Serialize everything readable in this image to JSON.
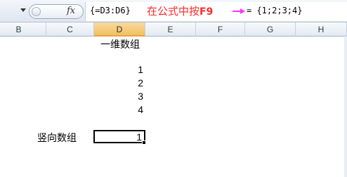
{
  "formula_bar": {
    "fx_label": "fx",
    "formula": "{=D3:D6}",
    "note": "在公式中按",
    "note_key": "F9",
    "result": "= {1;2;3;4}"
  },
  "columns": [
    "B",
    "C",
    "D",
    "E",
    "F",
    "G",
    "H"
  ],
  "selected_column": "D",
  "sheet": {
    "heading": "一维数组",
    "values": [
      "1",
      "2",
      "3",
      "4"
    ],
    "row_label": "竖向数组",
    "active_cell_value": "1"
  },
  "colors": {
    "note": "#ff2a2a",
    "arrow": "#ff33ff",
    "selected_header": "#f1c15f"
  }
}
